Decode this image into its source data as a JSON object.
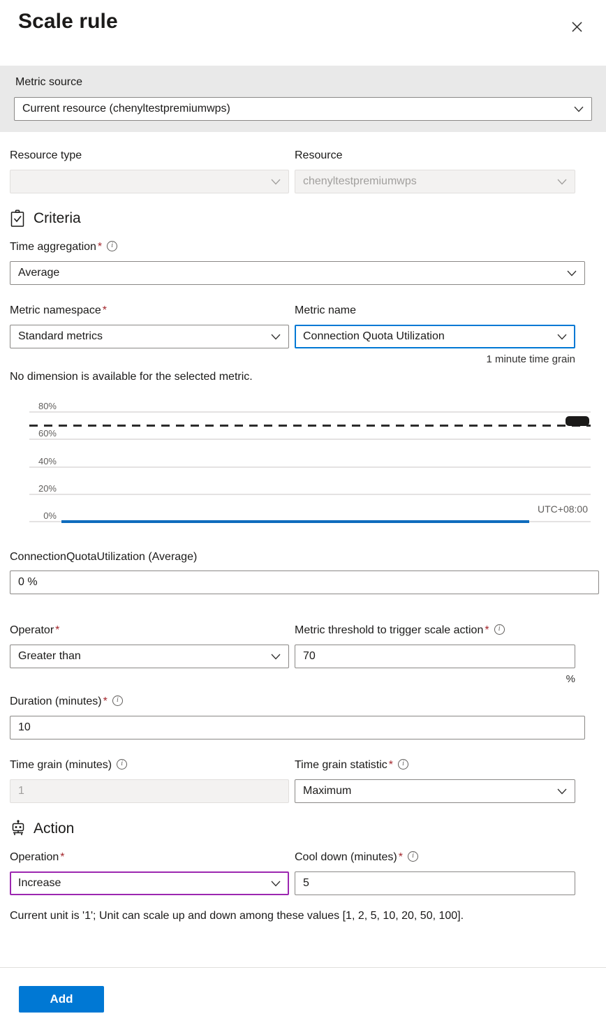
{
  "header": {
    "title": "Scale rule",
    "close_label": "Close"
  },
  "metric_source": {
    "label": "Metric source",
    "value": "Current resource (chenyltestpremiumwps)"
  },
  "resource": {
    "type_label": "Resource type",
    "type_value": "",
    "resource_label": "Resource",
    "resource_value": "chenyltestpremiumwps"
  },
  "criteria": {
    "heading": "Criteria",
    "time_aggregation_label": "Time aggregation",
    "time_aggregation_value": "Average",
    "metric_namespace_label": "Metric namespace",
    "metric_namespace_value": "Standard metrics",
    "metric_name_label": "Metric name",
    "metric_name_value": "Connection Quota Utilization",
    "time_grain_hint": "1 minute time grain",
    "dimension_note": "No dimension is available for the selected metric.",
    "timezone": "UTC+08:00",
    "series_label": "ConnectionQuotaUtilization (Average)",
    "series_value": "0 %",
    "operator_label": "Operator",
    "operator_value": "Greater than",
    "threshold_label": "Metric threshold to trigger scale action",
    "threshold_value": "70",
    "threshold_unit": "%",
    "duration_label": "Duration (minutes)",
    "duration_value": "10",
    "grain_label": "Time grain (minutes)",
    "grain_value": "1",
    "grain_stat_label": "Time grain statistic",
    "grain_stat_value": "Maximum",
    "required_marker": "*"
  },
  "action": {
    "heading": "Action",
    "operation_label": "Operation",
    "operation_value": "Increase",
    "cooldown_label": "Cool down (minutes)",
    "cooldown_value": "5",
    "unit_note": "Current unit is '1'; Unit can scale up and down among these values [1, 2, 5, 10, 20, 50, 100]."
  },
  "footer": {
    "add_label": "Add"
  },
  "colors": {
    "accent": "#0078d4",
    "focus_border": "#0078d4",
    "purple_border": "#9c27b0",
    "required_red": "#a4262c",
    "series_line": "#0f6cbd",
    "threshold_line": "#2b2b2b",
    "band_grey": "#e9e9e9"
  },
  "chart_data": {
    "type": "line",
    "title": "ConnectionQuotaUtilization (Average)",
    "xlabel": "",
    "ylabel": "",
    "ylim": [
      0,
      90
    ],
    "yticks": [
      0,
      20,
      40,
      60,
      80
    ],
    "ytick_labels": [
      "0%",
      "20%",
      "40%",
      "60%",
      "80%"
    ],
    "grid": true,
    "legend": null,
    "timezone": "UTC+08:00",
    "series": [
      {
        "name": "ConnectionQuotaUtilization (Average)",
        "color": "#0f6cbd",
        "values": [
          0,
          0,
          0,
          0,
          0,
          0,
          0,
          0,
          0,
          0,
          0,
          0,
          0,
          0,
          0,
          0,
          0,
          0,
          0,
          0
        ]
      }
    ],
    "threshold": {
      "label": "70",
      "value": 70,
      "style": "dashed",
      "color": "#2b2b2b",
      "handle": true
    }
  }
}
